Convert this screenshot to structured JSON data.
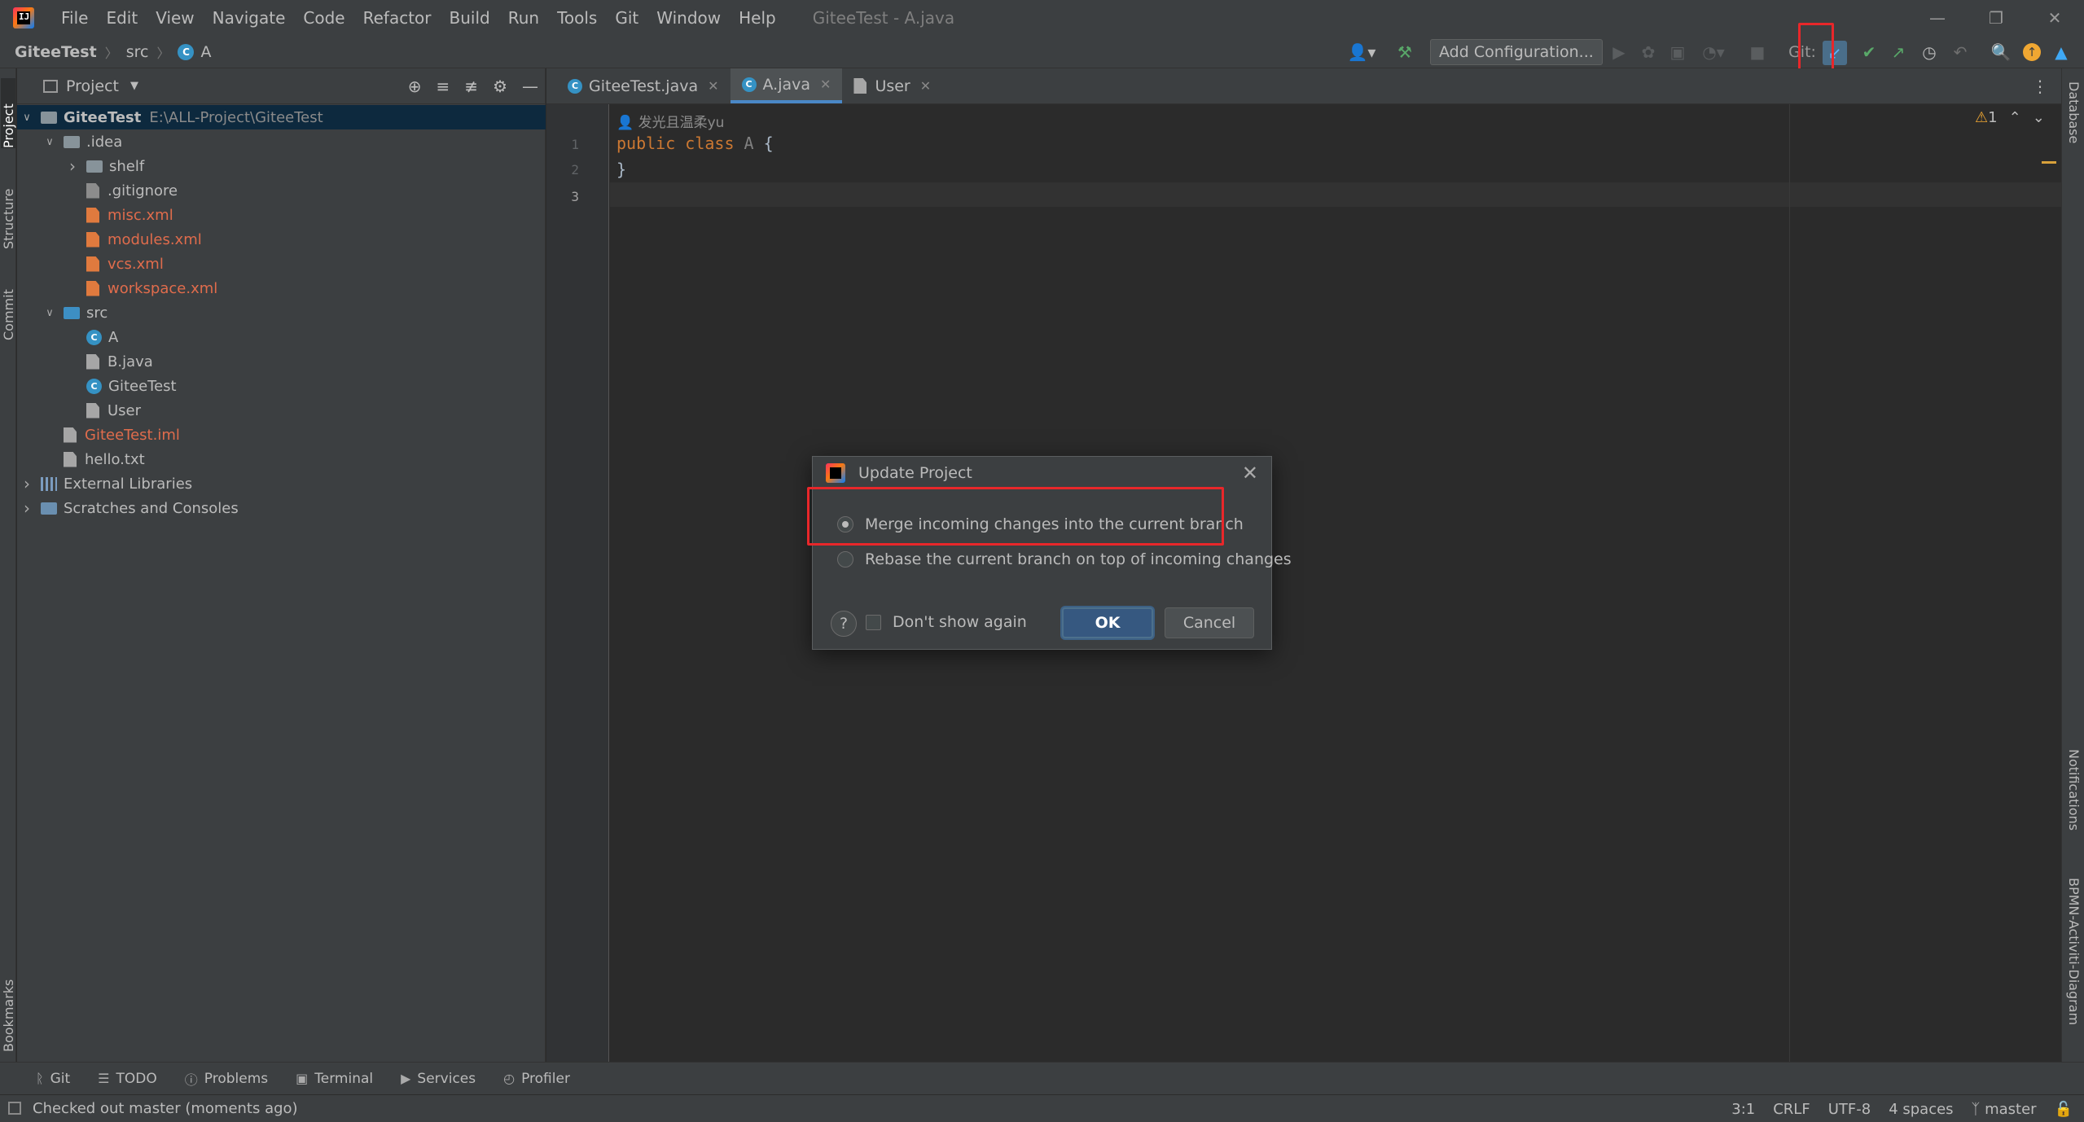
{
  "window": {
    "title": "GiteeTest - A.java",
    "menu": [
      "File",
      "Edit",
      "View",
      "Navigate",
      "Code",
      "Refactor",
      "Build",
      "Run",
      "Tools",
      "Git",
      "Window",
      "Help"
    ]
  },
  "navbar": {
    "project": "GiteeTest",
    "folder": "src",
    "file": "A",
    "add_configuration": "Add Configuration...",
    "git_label": "Git:"
  },
  "left_tabs": [
    "Project",
    "Structure",
    "Commit",
    "Bookmarks"
  ],
  "right_tabs": [
    "Database",
    "Notifications",
    "BPMN-Activiti-Diagram"
  ],
  "project_panel": {
    "title": "Project",
    "tree": [
      {
        "name": "GiteeTest",
        "path": "E:\\ALL-Project\\GiteeTest",
        "type": "project",
        "depth": 0,
        "expanded": true,
        "selected": true
      },
      {
        "name": ".idea",
        "type": "folder",
        "depth": 1,
        "expanded": true
      },
      {
        "name": "shelf",
        "type": "folder",
        "depth": 2,
        "expanded": false
      },
      {
        "name": ".gitignore",
        "type": "git",
        "depth": 2
      },
      {
        "name": "misc.xml",
        "type": "xml",
        "depth": 2,
        "modified": true
      },
      {
        "name": "modules.xml",
        "type": "xml",
        "depth": 2,
        "modified": true
      },
      {
        "name": "vcs.xml",
        "type": "xml",
        "depth": 2,
        "modified": true
      },
      {
        "name": "workspace.xml",
        "type": "xml",
        "depth": 2,
        "modified": true
      },
      {
        "name": "src",
        "type": "src",
        "depth": 1,
        "expanded": true
      },
      {
        "name": "A",
        "type": "class",
        "depth": 2
      },
      {
        "name": "B.java",
        "type": "file",
        "depth": 2
      },
      {
        "name": "GiteeTest",
        "type": "class",
        "depth": 2
      },
      {
        "name": "User",
        "type": "file",
        "depth": 2
      },
      {
        "name": "GiteeTest.iml",
        "type": "file",
        "depth": 1,
        "modified": true
      },
      {
        "name": "hello.txt",
        "type": "file",
        "depth": 1
      },
      {
        "name": "External Libraries",
        "type": "lib",
        "depth": 0,
        "expanded": false
      },
      {
        "name": "Scratches and Consoles",
        "type": "scratch",
        "depth": 0,
        "expanded": false
      }
    ]
  },
  "editor": {
    "tabs": [
      {
        "label": "GiteeTest.java",
        "icon": "class",
        "active": false
      },
      {
        "label": "A.java",
        "icon": "class",
        "active": true
      },
      {
        "label": "User",
        "icon": "file",
        "active": false
      }
    ],
    "author": "发光且温柔yu",
    "lines": [
      "1",
      "2",
      "3"
    ],
    "code_line1_kw": "public class",
    "code_line1_name": "A",
    "code_line1_brace": "{",
    "code_line2": "}",
    "warning_count": "1"
  },
  "bottom_tools": [
    {
      "label": "Git",
      "icon": "git-icon"
    },
    {
      "label": "TODO",
      "icon": "todo-icon"
    },
    {
      "label": "Problems",
      "icon": "problems-icon"
    },
    {
      "label": "Terminal",
      "icon": "terminal-icon"
    },
    {
      "label": "Services",
      "icon": "services-icon"
    },
    {
      "label": "Profiler",
      "icon": "profiler-icon"
    }
  ],
  "status": {
    "message": "Checked out master (moments ago)",
    "position": "3:1",
    "line_sep": "CRLF",
    "encoding": "UTF-8",
    "indent": "4 spaces",
    "branch": "master"
  },
  "dialog": {
    "title": "Update Project",
    "option_merge": "Merge incoming changes into the current branch",
    "option_rebase": "Rebase the current branch on top of incoming changes",
    "selected": "merge",
    "dont_show": "Don't show again",
    "ok": "OK",
    "cancel": "Cancel"
  },
  "colors": {
    "highlight": "#e8272a",
    "accent": "#4a88c7",
    "modified_file": "#e06c4c"
  }
}
